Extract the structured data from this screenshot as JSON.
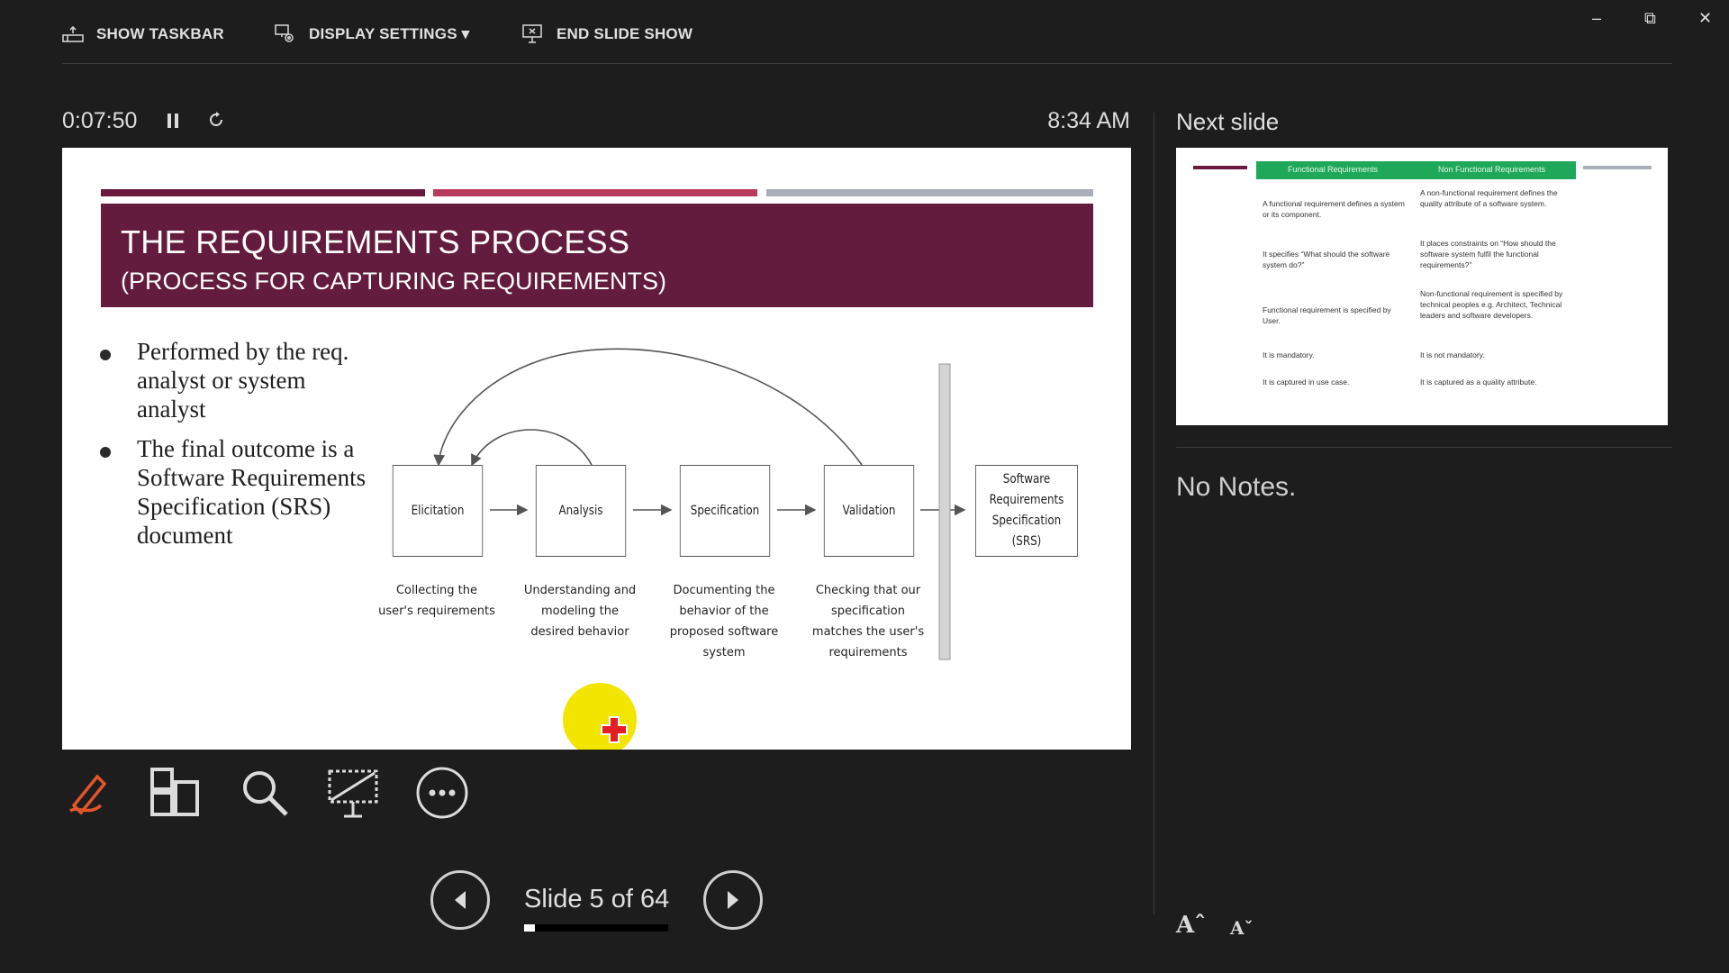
{
  "toolbar_top": {
    "show_taskbar": "SHOW TASKBAR",
    "display_settings": "DISPLAY SETTINGS ▾",
    "end_slide_show": "END SLIDE SHOW"
  },
  "window_controls": {
    "minimize": "–",
    "restore": "⧉",
    "close": "✕"
  },
  "timer": {
    "elapsed": "0:07:50",
    "clock": "8:34 AM"
  },
  "slide": {
    "title": "THE REQUIREMENTS PROCESS",
    "subtitle": "(PROCESS FOR CAPTURING REQUIREMENTS)",
    "bar_colors": [
      "#6b1a3d",
      "#b83b5e",
      "#a9aeb8"
    ],
    "title_bg": "#641c3e",
    "bullets": [
      "Performed by the req. analyst or system analyst",
      "The final outcome is a Software Requirements Specification (SRS) document"
    ],
    "process_steps": [
      {
        "label": "Elicitation",
        "description": "Collecting the user's requirements"
      },
      {
        "label": "Analysis",
        "description": "Understanding and modeling the desired behavior"
      },
      {
        "label": "Specification",
        "description": "Documenting the behavior of the proposed software system"
      },
      {
        "label": "Validation",
        "description": "Checking that our specification matches the user's requirements"
      }
    ],
    "output": "Software Requirements Specification (SRS)"
  },
  "tools": [
    "pen-tool-icon",
    "see-all-slides-icon",
    "zoom-icon",
    "black-screen-icon",
    "more-options-icon"
  ],
  "navigation": {
    "slide_counter": "Slide 5 of 64",
    "progress_fraction": 0.078
  },
  "next_slide": {
    "header": "Next slide",
    "table_headers": [
      "Functional Requirements",
      "Non Functional Requirements"
    ],
    "rows": [
      [
        "A functional requirement defines a system or its component.",
        "A non-functional requirement defines the quality attribute of a software system."
      ],
      [
        "It specifies “What should the software system do?”",
        "It places constraints on “How should the software system fulfil the functional requirements?”"
      ],
      [
        "Functional requirement is specified by User.",
        "Non-functional requirement is specified by technical peoples e.g. Architect, Technical leaders and software developers."
      ],
      [
        "It is mandatory.",
        "It is not mandatory."
      ],
      [
        "It is captured in use case.",
        "It is captured as a quality attribute."
      ]
    ],
    "accent": "#1fa85a"
  },
  "notes": {
    "text": "No Notes."
  },
  "font_controls": {
    "increase": "Aˆ",
    "decrease": "Aˇ"
  }
}
